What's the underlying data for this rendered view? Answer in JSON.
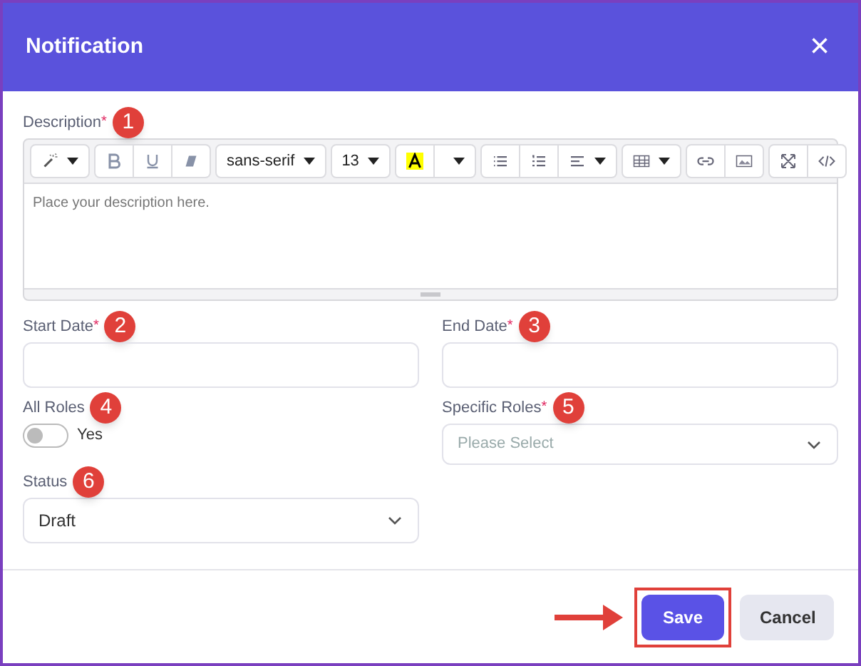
{
  "dialog": {
    "title": "Notification",
    "close": "×"
  },
  "description": {
    "label": "Description",
    "required_mark": "*",
    "marker": "1",
    "placeholder": "Place your description here.",
    "toolbar": [
      {
        "items": [
          {
            "kind": "icon_dropdown"
          }
        ]
      },
      {
        "items": [
          {
            "kind": "icon"
          },
          {
            "kind": "icon"
          },
          {
            "kind": "icon"
          }
        ]
      },
      {
        "items": [
          {
            "kind": "text_dropdown",
            "label": "sans-serif"
          }
        ]
      },
      {
        "items": [
          {
            "kind": "text_dropdown",
            "label": "13"
          }
        ]
      },
      {
        "items": [
          {
            "kind": "icon"
          },
          {
            "kind": "caret"
          }
        ]
      },
      {
        "items": [
          {
            "kind": "icon"
          },
          {
            "kind": "icon"
          },
          {
            "kind": "icon_dropdown"
          }
        ]
      },
      {
        "items": [
          {
            "kind": "icon_dropdown"
          }
        ]
      },
      {
        "items": [
          {
            "kind": "icon"
          },
          {
            "kind": "icon"
          }
        ]
      },
      {
        "items": [
          {
            "kind": "icon"
          },
          {
            "kind": "icon"
          }
        ]
      }
    ]
  },
  "start_date": {
    "label": "Start Date",
    "required_mark": "*",
    "marker": "2"
  },
  "end_date": {
    "label": "End Date",
    "required_mark": "*",
    "marker": "3"
  },
  "all_roles": {
    "label": "All Roles",
    "marker": "4",
    "on": false,
    "option": "Yes"
  },
  "specific_roles": {
    "label": "Specific Roles",
    "required_mark": "*",
    "marker": "5",
    "placeholder": "Please Select"
  },
  "status": {
    "label": "Status",
    "marker": "6",
    "value": "Draft"
  },
  "buttons": [
    {
      "label": "Save",
      "kind": "primary",
      "highlighted": true
    },
    {
      "label": "Cancel",
      "kind": "secondary",
      "highlighted": false
    }
  ]
}
